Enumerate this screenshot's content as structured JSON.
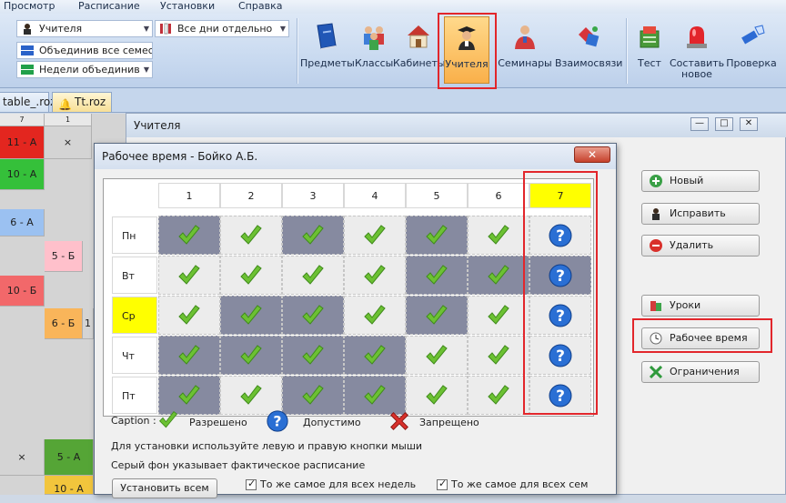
{
  "menu": [
    "Просмотр",
    "Расписание",
    "Установки",
    "Справка"
  ],
  "ribbon": {
    "combo_teacher": "Учителя",
    "combo_days": "Все дни отдельно",
    "merge_semesters": "Объединив все семестры",
    "merge_weeks": "Недели объединив",
    "buttons": {
      "subjects": "Предметы",
      "classes": "Классы",
      "rooms": "Кабинеты",
      "teachers": "Учителя",
      "seminars": "Семинары",
      "relations": "Взаимосвязи",
      "test": "Тест",
      "compose_new_1": "Составить",
      "compose_new_2": "новое",
      "check": "Проверка"
    }
  },
  "tabs": [
    "table_.roz",
    "Tt.roz"
  ],
  "bg_grid": {
    "headers": [
      "7",
      "1"
    ],
    "cells": [
      "11 - А",
      "×",
      "10 - А",
      "6 - А",
      "5 - Б",
      "10 - Б",
      "6 - Б",
      "1",
      "×",
      "5 - А",
      "10 - А"
    ]
  },
  "teachers_window": {
    "title": "Учителя",
    "buttons": {
      "new": "Новый",
      "edit": "Исправить",
      "delete": "Удалить",
      "lessons": "Уроки",
      "working_time": "Рабочее время",
      "constraints": "Ограничения"
    }
  },
  "dialog": {
    "title": "Рабочее время - Бойко А.Б.",
    "close": "✕",
    "columns": [
      "1",
      "2",
      "3",
      "4",
      "5",
      "6",
      "7"
    ],
    "rows": [
      {
        "day": "Пн",
        "highlight": false,
        "cells": [
          "ok",
          "ok",
          "ok",
          "ok",
          "ok",
          "ok",
          "q"
        ]
      },
      {
        "day": "Вт",
        "highlight": false,
        "cells": [
          "ok",
          "ok",
          "ok",
          "ok",
          "ok",
          "ok",
          "q"
        ]
      },
      {
        "day": "Ср",
        "highlight": true,
        "cells": [
          "ok",
          "ok",
          "ok",
          "ok",
          "ok",
          "ok",
          "q"
        ]
      },
      {
        "day": "Чт",
        "highlight": false,
        "cells": [
          "ok",
          "ok",
          "ok",
          "ok",
          "ok",
          "ok",
          "q"
        ]
      },
      {
        "day": "Пт",
        "highlight": false,
        "cells": [
          "ok",
          "ok",
          "ok",
          "ok",
          "ok",
          "ok",
          "q"
        ]
      }
    ],
    "legend": {
      "caption": "Caption :",
      "allowed": "Разрешено",
      "acceptable": "Допустимо",
      "forbidden": "Запрещено"
    },
    "hint1": "Для установки используйте левую и правую кнопки мыши",
    "hint2": "Серый фон указывает фактическое расписание",
    "set_all": "Установить всем",
    "same_weeks": "То же самое для всех недель",
    "same_semesters": "То же самое для всех семестр"
  },
  "colors": {
    "ok": "#6cc133",
    "q": "#2a6fd4",
    "no": "#d9302b",
    "gray_cell": "#868aa0",
    "highlight": "#ffff00",
    "accent_box": "#e2262b"
  }
}
